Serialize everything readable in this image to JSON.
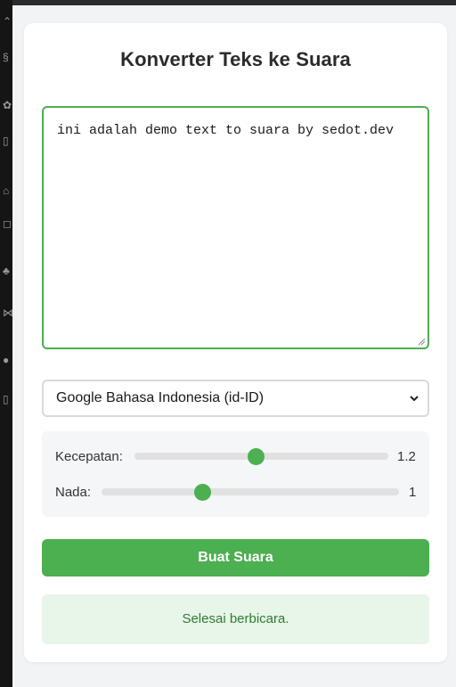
{
  "app": {
    "title": "Konverter Teks ke Suara"
  },
  "textarea": {
    "value": "ini adalah demo text to suara by sedot.dev"
  },
  "voice_select": {
    "selected": "Google Bahasa Indonesia (id-ID)",
    "icon": "chevron-down-icon"
  },
  "controls": {
    "speed": {
      "label": "Kecepatan:",
      "value": "1.2",
      "fraction": 0.48
    },
    "pitch": {
      "label": "Nada:",
      "value": "1",
      "fraction": 0.34
    }
  },
  "actions": {
    "generate_label": "Buat Suara"
  },
  "status": {
    "message": "Selesai berbicara."
  },
  "colors": {
    "accent": "#4caf50",
    "status_bg": "#e8f5e9",
    "status_text": "#2e7d32"
  }
}
